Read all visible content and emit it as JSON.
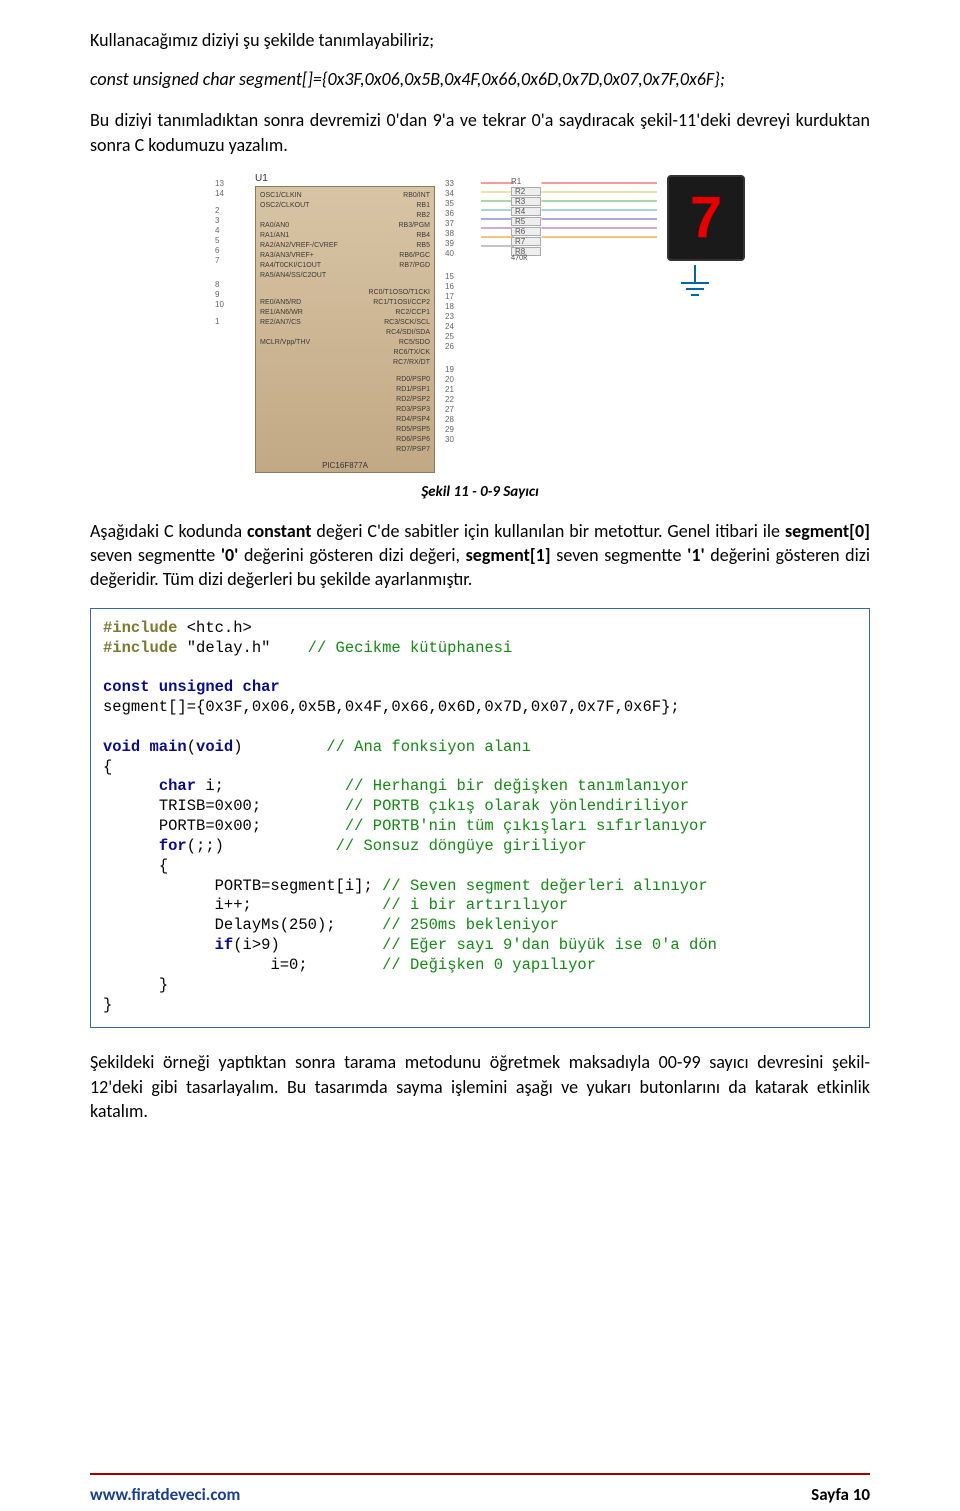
{
  "intro": {
    "l1": "Kullanacağımız diziyi şu şekilde tanımlayabiliriz;",
    "l2": "const unsigned char segment[]={0x3F,0x06,0x5B,0x4F,0x66,0x6D,0x7D,0x07,0x7F,0x6F};",
    "p1": "Bu diziyi tanımladıktan sonra devremizi 0'dan 9'a ve tekrar 0'a saydıracak şekil-11'deki devreyi kurduktan sonra C kodumuzu yazalım."
  },
  "diagram": {
    "u1": "U1",
    "chip_model": "PIC16F877A",
    "pins_left": [
      "13",
      "14",
      "",
      "2",
      "3",
      "4",
      "5",
      "6",
      "7",
      "",
      "",
      "8",
      "9",
      "10",
      "",
      "1"
    ],
    "pins_right_block1": [
      "33",
      "34",
      "35",
      "36",
      "37",
      "38",
      "39",
      "40"
    ],
    "pins_right_block2": [
      "15",
      "16",
      "17",
      "18",
      "23",
      "24",
      "25",
      "26"
    ],
    "pins_right_block3": [
      "19",
      "20",
      "21",
      "22",
      "27",
      "28",
      "29",
      "30"
    ],
    "chip_rows1": [
      {
        "l": "OSC1/CLKIN",
        "r": "RB0/INT"
      },
      {
        "l": "OSC2/CLKOUT",
        "r": "RB1"
      },
      {
        "l": "",
        "r": "RB2"
      },
      {
        "l": "RA0/AN0",
        "r": "RB3/PGM"
      },
      {
        "l": "RA1/AN1",
        "r": "RB4"
      },
      {
        "l": "RA2/AN2/VREF-/CVREF",
        "r": "RB5"
      },
      {
        "l": "RA3/AN3/VREF+",
        "r": "RB6/PGC"
      },
      {
        "l": "RA4/T0CKI/C1OUT",
        "r": "RB7/PGD"
      },
      {
        "l": "RA5/AN4/SS/C2OUT",
        "r": ""
      }
    ],
    "chip_rows2": [
      {
        "l": "",
        "r": "RC0/T1OSO/T1CKI"
      },
      {
        "l": "RE0/AN5/RD",
        "r": "RC1/T1OSI/CCP2"
      },
      {
        "l": "RE1/AN6/WR",
        "r": "RC2/CCP1"
      },
      {
        "l": "RE2/AN7/CS",
        "r": "RC3/SCK/SCL"
      },
      {
        "l": "",
        "r": "RC4/SDI/SDA"
      },
      {
        "l": "MCLR/Vpp/THV",
        "r": "RC5/SDO"
      },
      {
        "l": "",
        "r": "RC6/TX/CK"
      },
      {
        "l": "",
        "r": "RC7/RX/DT"
      }
    ],
    "chip_rows3": [
      {
        "l": "",
        "r": "RD0/PSP0"
      },
      {
        "l": "",
        "r": "RD1/PSP1"
      },
      {
        "l": "",
        "r": "RD2/PSP2"
      },
      {
        "l": "",
        "r": "RD3/PSP3"
      },
      {
        "l": "",
        "r": "RD4/PSP4"
      },
      {
        "l": "",
        "r": "RD5/PSP5"
      },
      {
        "l": "",
        "r": "RD6/PSP6"
      },
      {
        "l": "",
        "r": "RD7/PSP7"
      }
    ],
    "resistors_header": "R1",
    "resistors": [
      "R2",
      "R3",
      "R4",
      "R5",
      "R6",
      "R7",
      "R8"
    ],
    "resistor_value": "470R",
    "seg_digit": "7"
  },
  "caption": "Şekil 11 - 0-9 Sayıcı",
  "para2_t1": "Aşağıdaki C kodunda ",
  "para2_b1": "constant",
  "para2_t2": " değeri C'de sabitler için kullanılan bir metottur. Genel itibari ile ",
  "para2_b2": "segment[0]",
  "para2_t3": " seven segmentte ",
  "para2_b3": "'0'",
  "para2_t4": " değerini gösteren dizi değeri, ",
  "para2_b4": "segment[1]",
  "para2_t5": " seven segmentte ",
  "para2_b5": "'1'",
  "para2_t6": " değerini gösteren dizi değeridir. Tüm dizi değerleri bu şekilde ayarlanmıştır.",
  "code": {
    "inc1_kw": "#include",
    "inc1_rest": " <htc.h>",
    "inc2_kw": "#include",
    "inc2_str": " \"delay.h\"",
    "inc2_pad": "    ",
    "inc2_c": "// Gecikme kütüphanesi",
    "const_kw": "const unsigned char",
    "arr": "segment[]={0x3F,0x06,0x5B,0x4F,0x66,0x6D,0x7D,0x07,0x7F,0x6F};",
    "main_kw": "void main",
    "main_paren": "(",
    "main_kw2": "void",
    "main_paren2": ")",
    "main_pad": "         ",
    "main_c": "// Ana fonksiyon alanı",
    "br_o": "{",
    "char_pad": "      ",
    "char_kw": "char",
    "char_rest": " i;",
    "char_pad2": "             ",
    "char_c": "// Herhangi bir değişken tanımlanıyor",
    "trisb_pad": "      ",
    "trisb": "TRISB=0x00;",
    "trisb_pad2": "         ",
    "trisb_c": "// PORTB çıkış olarak yönlendiriliyor",
    "portb_pad": "      ",
    "portb": "PORTB=0x00;",
    "portb_pad2": "         ",
    "portb_c": "// PORTB'nin tüm çıkışları sıfırlanıyor",
    "for_pad": "      ",
    "for_kw": "for",
    "for_p": "(;;)",
    "for_pad2": "            ",
    "for_c": "// Sonsuz döngüye giriliyor",
    "br_o2_pad": "      ",
    "br_o2": "{",
    "seg_pad": "            ",
    "seg": "PORTB=segment[i]; ",
    "seg_c": "// Seven segment değerleri alınıyor",
    "ipp_pad": "            ",
    "ipp": "i++;",
    "ipp_pad2": "              ",
    "ipp_c": "// i bir artırılıyor",
    "dly_pad": "            ",
    "dly": "DelayMs(250);",
    "dly_pad2": "     ",
    "dly_c": "// 250ms bekleniyor",
    "if_pad": "            ",
    "if_kw": "if",
    "if_p": "(i>9)",
    "if_pad2": "           ",
    "if_c": "// Eğer sayı 9'dan büyük ise 0'a dön",
    "iz_pad": "                  ",
    "iz": "i=0;",
    "iz_pad2": "        ",
    "iz_c": "// Değişken 0 yapılıyor",
    "br_c2_pad": "      ",
    "br_c2": "}",
    "br_c": "}"
  },
  "para3": "Şekildeki örneği yaptıktan sonra tarama metodunu öğretmek maksadıyla 00-99 sayıcı devresini şekil-12'deki gibi tasarlayalım. Bu tasarımda sayma işlemini aşağı ve yukarı butonlarını da katarak etkinlik katalım.",
  "footer": {
    "site": "www.firatdeveci.com",
    "page": "Sayfa 10"
  }
}
